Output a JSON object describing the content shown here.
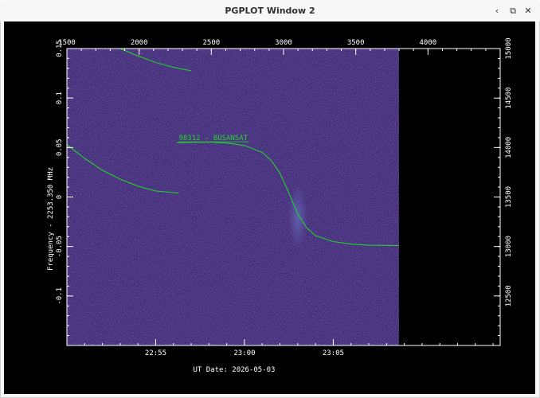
{
  "window": {
    "title": "PGPLOT Window 2",
    "buttons": {
      "minimize": "‹",
      "restore": "⧉",
      "close": "✕"
    }
  },
  "colors": {
    "plot_background": "#432c78",
    "curve": "#22d22b",
    "axis": "#ffffff",
    "outside": "#000000"
  },
  "chart_data": {
    "type": "heatmap",
    "xlabel": "UT Date: 2026-05-03",
    "ylabel": "Frequency - 2253.350 MHz",
    "annotation": "98312 - BUSANSAT",
    "bottom_ticks": [
      "22:55",
      "23:00",
      "23:05"
    ],
    "bottom_tick_minutes": [
      5,
      10,
      15
    ],
    "bottom_range_minutes": [
      0,
      24.4
    ],
    "data_end_minute": 18.7,
    "top_ticks": [
      "1500",
      "2000",
      "2500",
      "3000",
      "3500",
      "4000"
    ],
    "top_range": [
      1500,
      4500
    ],
    "left_ticks": [
      "0.15",
      "0.1",
      "0.05",
      "0",
      "-0.05",
      "-0.1"
    ],
    "left_tick_values": [
      0.15,
      0.1,
      0.05,
      0,
      -0.05,
      -0.1
    ],
    "left_range": [
      -0.15,
      0.15
    ],
    "right_ticks": [
      "15000",
      "14500",
      "14000",
      "13500",
      "13000",
      "12500"
    ],
    "right_tick_values": [
      15000,
      14500,
      14000,
      13500,
      13000,
      12500
    ],
    "right_range": [
      12000,
      15000
    ],
    "curves": [
      {
        "x": [
          3.0,
          4.0,
          5.0,
          6.0,
          7.0
        ],
        "y": [
          0.15,
          0.1425,
          0.136,
          0.131,
          0.1275
        ]
      },
      {
        "x": [
          0.0,
          1.0,
          2.0,
          3.0,
          4.0,
          5.0,
          6.3
        ],
        "y": [
          0.053,
          0.039,
          0.027,
          0.018,
          0.011,
          0.006,
          0.004
        ]
      },
      {
        "x": [
          6.2,
          8.0,
          9.0,
          10.0,
          11.0,
          11.5,
          12.0,
          12.5,
          13.0,
          13.5,
          14.0,
          15.0,
          16.0,
          17.0,
          18.7
        ],
        "y": [
          0.055,
          0.0555,
          0.0545,
          0.052,
          0.045,
          0.037,
          0.024,
          0.004,
          -0.017,
          -0.031,
          -0.039,
          -0.045,
          -0.0475,
          -0.0487,
          -0.049
        ]
      }
    ]
  }
}
